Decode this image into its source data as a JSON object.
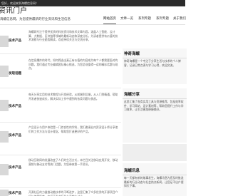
{
  "topbar": {
    "text": "您好，欢迎来到海螺信息网！"
  },
  "header": {
    "title": "资讯门户",
    "subtitle": "海螺信息网，为您提供最新的行业资讯和生活信息"
  },
  "nav": {
    "items": [
      "网站首页",
      "文章一览",
      "系列专题",
      "系列专题",
      "关于我们"
    ]
  },
  "posts": [
    {
      "title": "技术产品",
      "body": "海螺网专注于提供优质的科技资讯和技术文章内容，涵盖人工智能、云计算、大数据、区块链等领域的最新动态和深度分析，为读者提供有价值的技术洞察与行业趋势解读，欢迎持续关注与交流分享。"
    },
    {
      "title": "发现话题",
      "body": "在信息爆炸的时代，如何筛选出真正有价值的内容成为每个人都需要面对的问题。我们通过专业编辑团队精心挑选，为您呈现值得一读的精彩话题与观点。"
    },
    {
      "title": "技术产品",
      "body": "每天分享实用的技术教程与开发经验，从前端到后端，从入门到精通，帮助开发者快速成长，解决实际工作中遇到的各类问题与挑战。"
    },
    {
      "title": "技术产品",
      "body": "产品设计与用户体验是一门综合性的学科，我们邀请业内资深设计师分享他们的工作方法与设计理念，帮助您打造更好的产品。"
    },
    {
      "title": "技术产品",
      "body": "移动互联网的发展改变了人们的生活方式，本栏目关注移动应用开发、移动营销与移动支付等热门话题，为您带来第一手资讯。"
    },
    {
      "title": "技术产品",
      "body": "开源社区的力量推动着技术的不断进步，这里汇集了众多优秀的开源项目介绍与使用指南，欢迎开发者们参与贡献与讨论。"
    }
  ],
  "sidebar": {
    "panels": [
      {
        "title": "神奇海螺",
        "body": "神奇海螺是一个专注于分享生活与技术的个人博客，记录日常点滴与学习心得，欢迎交流。"
      },
      {
        "title": "海螺分享",
        "body": "这里汇集了各类实用工具与资源推荐，包括效率软件、学习网站、设计素材等，帮助您提升工作与学习效率，让生活更加便捷美好。"
      },
      {
        "title": "海螺讯息",
        "body": "每一天都有新的故事发生，海螺讯息为您及时推送最新的行业动态与社会热点新闻，让您足不出户便知天下事。"
      }
    ]
  }
}
